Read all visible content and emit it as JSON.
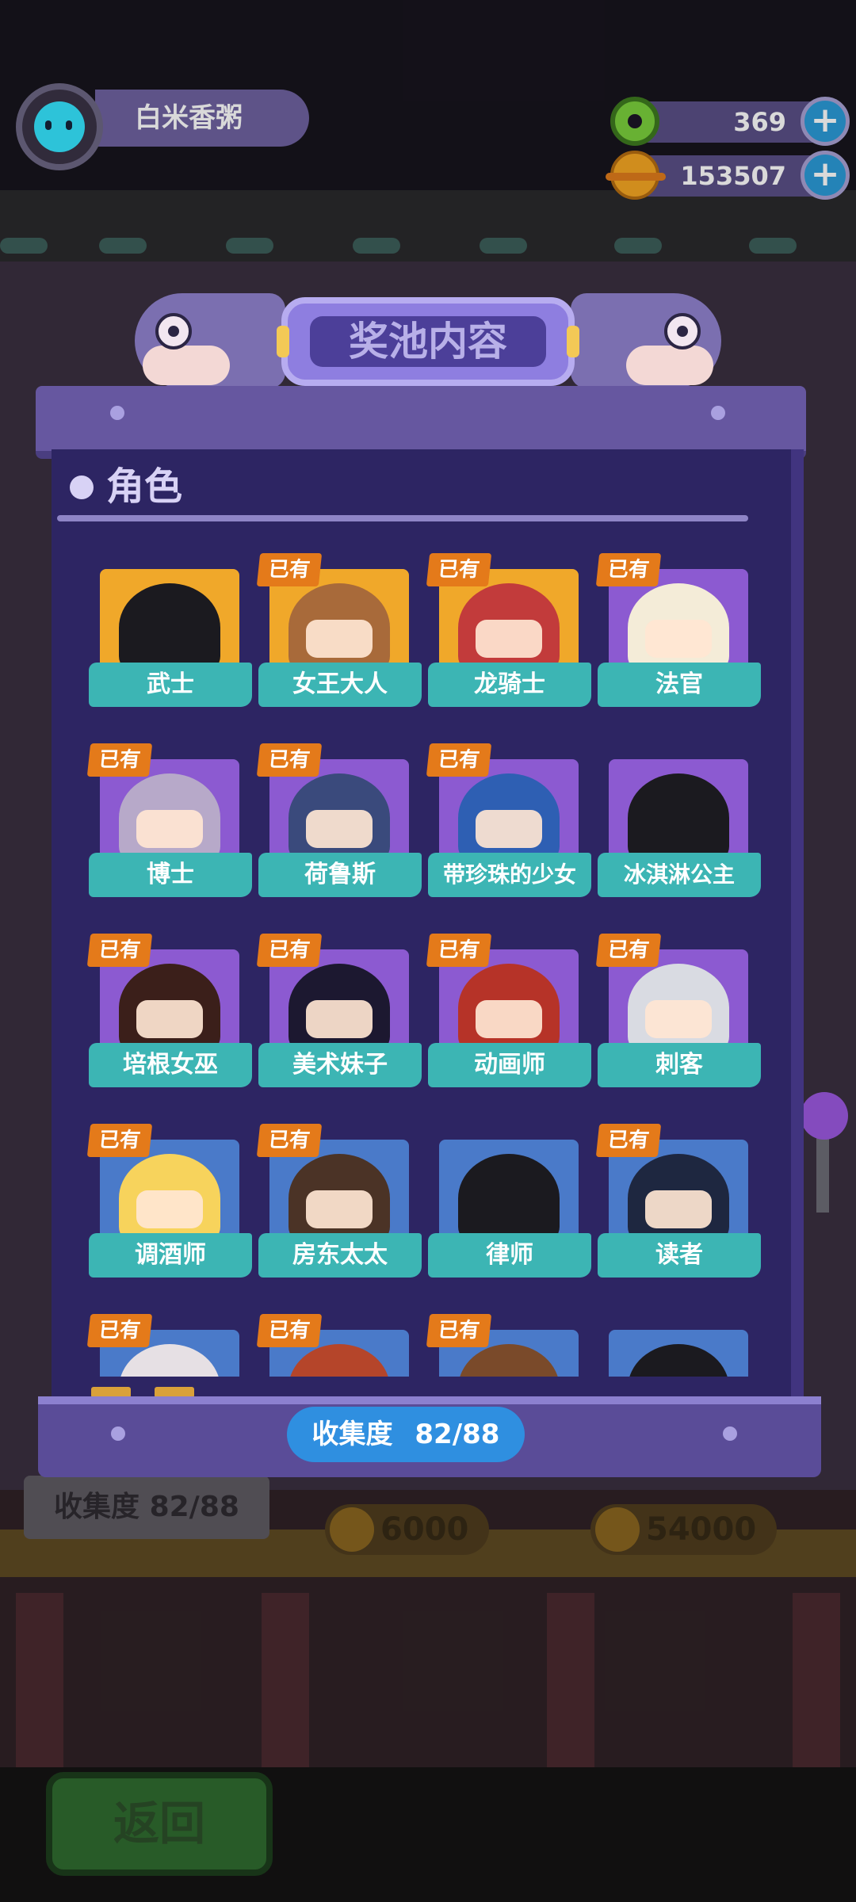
{
  "header": {
    "user_name": "白米香粥",
    "currencies": [
      {
        "icon": "donut-icon",
        "value": "369"
      },
      {
        "icon": "coin-icon",
        "value": "153507"
      }
    ]
  },
  "panel": {
    "title": "奖池内容",
    "section_title": "角色",
    "owned_badge": "已有",
    "collection_label": "收集度",
    "collection_value": "82/88",
    "characters": [
      {
        "name": "武士",
        "owned": false,
        "tile": "gold",
        "color": "#1b1a1f"
      },
      {
        "name": "女王大人",
        "owned": true,
        "tile": "gold",
        "color": "#a86a3a"
      },
      {
        "name": "龙骑士",
        "owned": true,
        "tile": "gold",
        "color": "#c23b3b"
      },
      {
        "name": "法官",
        "owned": true,
        "tile": "purple",
        "color": "#f4ecd8"
      },
      {
        "name": "博士",
        "owned": true,
        "tile": "purple",
        "color": "#b7a9c9"
      },
      {
        "name": "荷鲁斯",
        "owned": true,
        "tile": "purple",
        "color": "#3a4a7c"
      },
      {
        "name": "带珍珠的少女",
        "owned": true,
        "tile": "purple",
        "color": "#2e5fb3"
      },
      {
        "name": "冰淇淋公主",
        "owned": false,
        "tile": "purple",
        "color": "#1b1a1f"
      },
      {
        "name": "培根女巫",
        "owned": true,
        "tile": "purple",
        "color": "#3b1f1a"
      },
      {
        "name": "美术妹子",
        "owned": true,
        "tile": "purple",
        "color": "#1c1830"
      },
      {
        "name": "动画师",
        "owned": true,
        "tile": "purple",
        "color": "#b63328"
      },
      {
        "name": "刺客",
        "owned": true,
        "tile": "purple",
        "color": "#d9dbe2"
      },
      {
        "name": "调酒师",
        "owned": true,
        "tile": "blue",
        "color": "#f7d35c"
      },
      {
        "name": "房东太太",
        "owned": true,
        "tile": "blue",
        "color": "#4b3326"
      },
      {
        "name": "律师",
        "owned": false,
        "tile": "blue",
        "color": "#1b1a1f"
      },
      {
        "name": "读者",
        "owned": true,
        "tile": "blue",
        "color": "#1e2740"
      },
      {
        "name": "",
        "owned": true,
        "tile": "blue",
        "color": "#e6e0e4"
      },
      {
        "name": "",
        "owned": true,
        "tile": "blue",
        "color": "#b5452a"
      },
      {
        "name": "",
        "owned": true,
        "tile": "blue",
        "color": "#7a4a2a"
      },
      {
        "name": "",
        "owned": false,
        "tile": "blue",
        "color": "#1b1a1f"
      }
    ]
  },
  "background": {
    "collection_text": "收集度 82/88",
    "prices": [
      "6000",
      "54000"
    ],
    "back_label": "返回"
  }
}
